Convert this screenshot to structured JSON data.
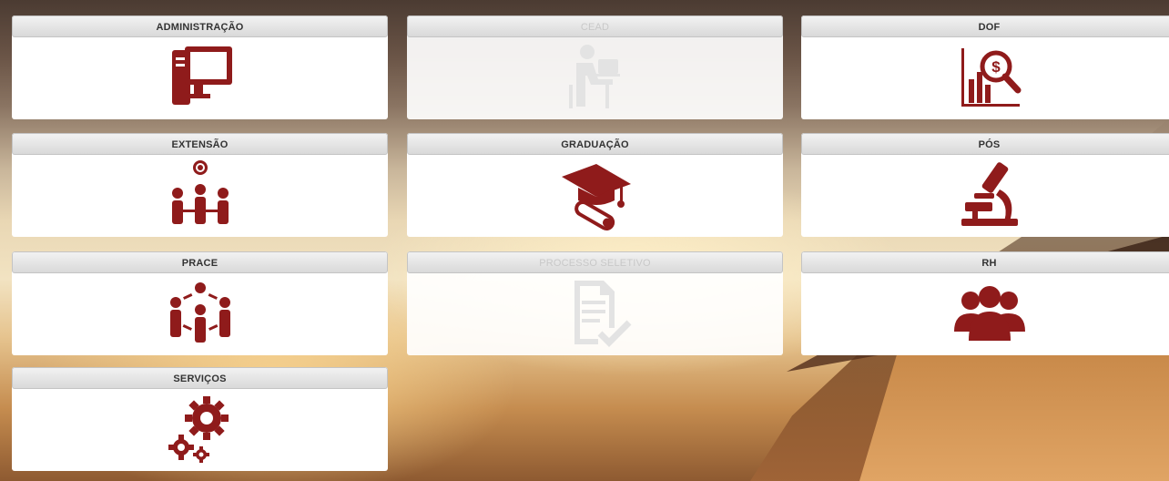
{
  "colors": {
    "icon_active": "#8f1b1b",
    "icon_disabled": "#e3e3e3"
  },
  "tiles": [
    {
      "label": "ADMINISTRAÇÃO",
      "icon": "computer-icon",
      "enabled": true
    },
    {
      "label": "CEAD",
      "icon": "person-at-desk-icon",
      "enabled": false
    },
    {
      "label": "DOF",
      "icon": "financial-chart-search-icon",
      "enabled": true
    },
    {
      "label": "EXTENSÃO",
      "icon": "community-globe-icon",
      "enabled": true
    },
    {
      "label": "GRADUAÇÃO",
      "icon": "graduation-cap-diploma-icon",
      "enabled": true
    },
    {
      "label": "PÓS",
      "icon": "microscope-icon",
      "enabled": true
    },
    {
      "label": "PRACE",
      "icon": "people-network-icon",
      "enabled": true
    },
    {
      "label": "PROCESSO SELETIVO",
      "icon": "document-check-icon",
      "enabled": false
    },
    {
      "label": "RH",
      "icon": "users-group-icon",
      "enabled": true
    },
    {
      "label": "SERVIÇOS",
      "icon": "gears-icon",
      "enabled": true
    }
  ]
}
